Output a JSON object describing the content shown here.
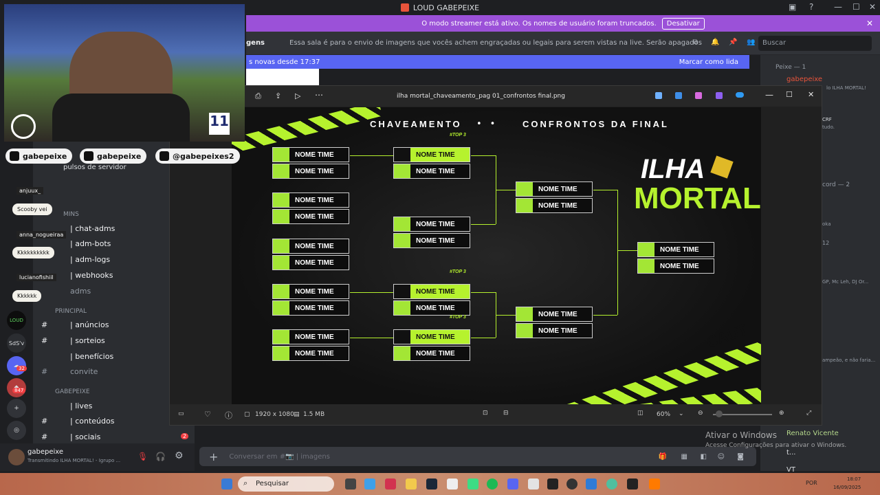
{
  "window": {
    "title": "LOUD GABEPEIXE"
  },
  "streamer_banner": {
    "text": "O modo streamer está ativo. Os nomes de usuário foram truncados.",
    "button": "Desativar"
  },
  "channel_header": {
    "name_fragment": "gens",
    "topic": "Essa sala é para o envio de imagens que vocês achem engraçadas ou legais para serem vistas na live. Serão apagados prints de outras redes sociais c...",
    "search_placeholder": "Buscar"
  },
  "new_messages": {
    "text": "s novas desde 17:37",
    "mark_read": "Marcar como lida"
  },
  "viewer": {
    "filename": "ilha mortal_chaveamento_pag 01_confrontos final.png",
    "dimensions": "1920 x 1080",
    "filesize": "1.5 MB",
    "zoom": "60%"
  },
  "artwork": {
    "title_left": "CHAVEAMENTO",
    "title_right": "CONFRONTOS DA FINAL",
    "slot_label": "NOME TIME",
    "top3_tag": "#TOP 3",
    "logo_line1": "ILHA",
    "logo_line2": "MORTAL",
    "caution": "CAUT"
  },
  "webcam": {
    "socials": [
      "gabepeixe",
      "gabepeixe",
      "@gabepeixes2"
    ]
  },
  "chat_overlay": {
    "users": [
      "anjuux_",
      "anna_nogueiraa",
      "lucianofishiil"
    ],
    "messages": [
      "Scooby vei",
      "Kkkkkkkkkk",
      "Kkkkkk"
    ]
  },
  "sidebar": {
    "channels_top": [
      "| chat-adms",
      "| adm-bots",
      "| adm-logs",
      "| webhooks",
      "adms"
    ],
    "fragment_impulsos": "pulsos de servidor",
    "fragment_admins": "MINS",
    "category_principal": "PRINCIPAL",
    "principal_channels": [
      "| anúncios",
      "| sorteios",
      "| benefícios",
      "convite"
    ],
    "category_gabepeixe": "GABEPEIXE",
    "gabepeixe_channels": [
      "| lives",
      "| conteúdos",
      "| sociais"
    ],
    "server_labels": [
      "SdS'v",
      "LOUD"
    ],
    "badges": [
      "32",
      "847",
      "2"
    ]
  },
  "user_panel": {
    "name": "gabepeixe",
    "status": "Transmitindo ILHA MORTAL! - Igrupo ..."
  },
  "composer": {
    "placeholder": "Conversar em #📷 | imagens"
  },
  "member_list": {
    "group": "Peixe — 1",
    "top_member": "gabepeixe",
    "fragments": [
      "lo ILHA MORTAL!",
      "CRF",
      "tudo.",
      "cord — 2",
      "oka",
      "12",
      "GP, Mc Leh, DJ Or...",
      "ampeão, e não faria..."
    ],
    "bottom_members": [
      "Renato Vicente",
      "t...",
      "VT"
    ]
  },
  "activation": {
    "title": "Ativar o Windows",
    "subtitle": "Acesse Configurações para ativar o Windows."
  },
  "taskbar": {
    "search": "Pesquisar",
    "lang": "POR",
    "time": "18:07",
    "date": "16/09/2025"
  },
  "colors": {
    "accent_green": "#b6f22e",
    "discord_blurple": "#5865f2",
    "streamer_purple": "#9b51d8"
  }
}
